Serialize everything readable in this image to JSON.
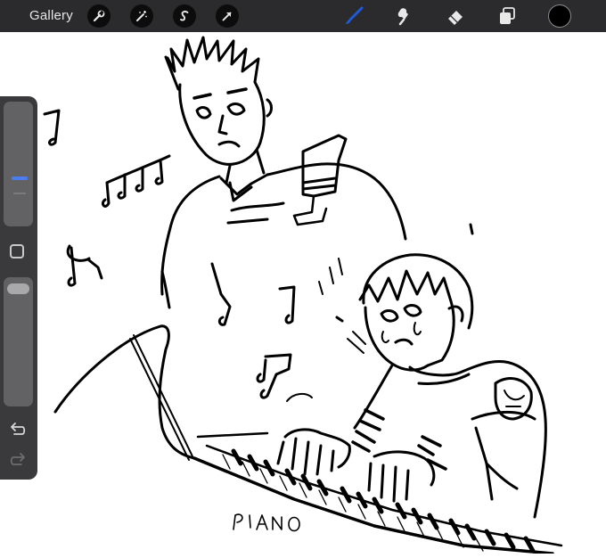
{
  "topbar": {
    "gallery_label": "Gallery",
    "left_tools": [
      "wrench-icon",
      "magic-wand-icon",
      "selection-s-icon",
      "arrow-transform-icon"
    ],
    "right_tools": [
      "brush-icon",
      "smudge-icon",
      "eraser-icon",
      "layers-icon"
    ],
    "active_tool": "brush-icon",
    "active_color": "#1f5ad8",
    "current_color": "#000000"
  },
  "sidebar": {
    "brush_size_level": 0.22,
    "opacity_level": 1.0,
    "modifier": "modifier-square-icon",
    "undo": "undo-arrow-icon",
    "redo": "redo-arrow-icon"
  },
  "canvas": {
    "lettering": "PIANO"
  }
}
